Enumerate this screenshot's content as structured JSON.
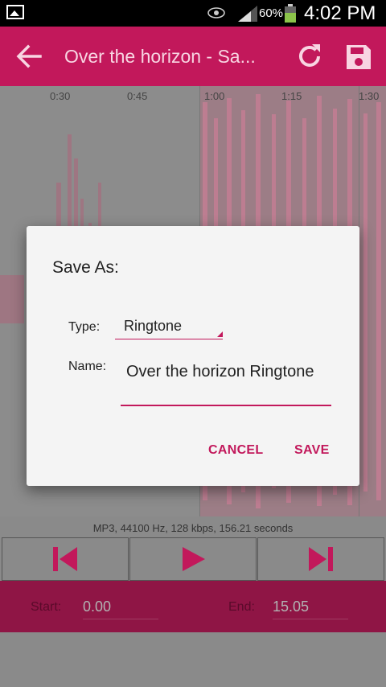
{
  "status_bar": {
    "battery_percent": "60%",
    "time": "4:02 PM",
    "icons": [
      "gallery-icon",
      "eye-icon",
      "signal-icon",
      "battery-icon"
    ]
  },
  "toolbar": {
    "title": "Over the horizon - Sa...",
    "icons": [
      "back-arrow-icon",
      "reload-icon",
      "save-disk-icon"
    ]
  },
  "timeline": {
    "ticks": [
      "0:30",
      "0:45",
      "1:00",
      "1:15",
      "1:30"
    ]
  },
  "file_info": "MP3, 44100 Hz, 128 kbps, 156.21 seconds",
  "controls": {
    "icons": [
      "skip-back-icon",
      "play-icon",
      "skip-forward-icon"
    ]
  },
  "range": {
    "start_label": "Start:",
    "start_value": "0.00",
    "end_label": "End:",
    "end_value": "15.05"
  },
  "dialog": {
    "title": "Save As:",
    "type_label": "Type:",
    "type_value": "Ringtone",
    "name_label": "Name:",
    "name_value": "Over the horizon Ringtone",
    "cancel_label": "CANCEL",
    "save_label": "SAVE"
  },
  "colors": {
    "accent": "#c2185b",
    "dim_accent": "#8f1545",
    "dialog_bg": "#f4f4f4"
  }
}
